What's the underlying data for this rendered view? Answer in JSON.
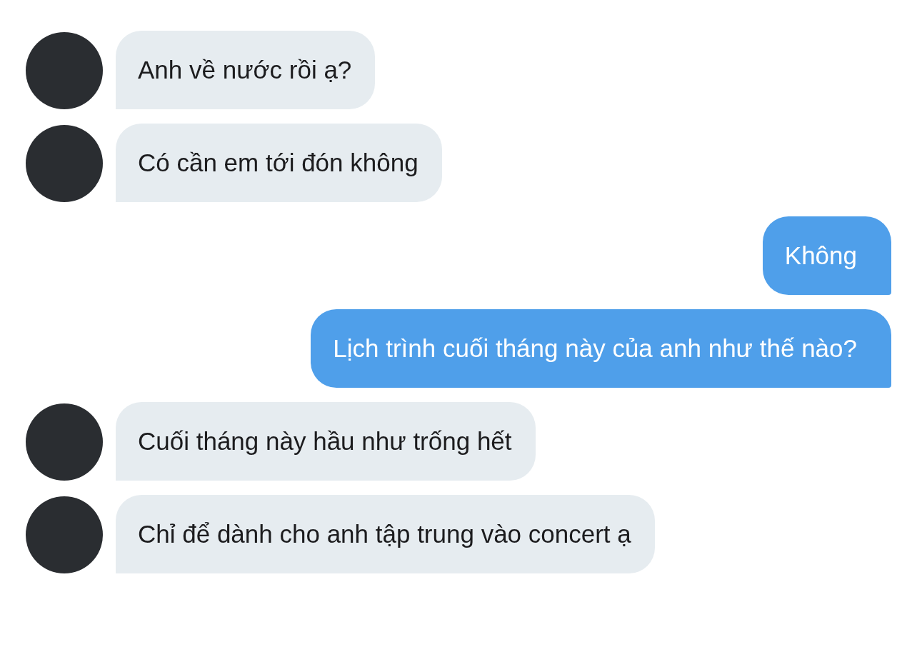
{
  "messages": [
    {
      "kind": "incoming",
      "text": "Anh về nước rồi ạ?"
    },
    {
      "kind": "incoming",
      "text": "Có cần em tới đón không"
    },
    {
      "kind": "outgoing",
      "text": "Không"
    },
    {
      "kind": "outgoing",
      "text": "Lịch trình cuối tháng này của anh như thế nào?"
    },
    {
      "kind": "incoming",
      "text": "Cuối tháng này hầu như trống hết"
    },
    {
      "kind": "incoming",
      "text": "Chỉ để dành cho anh tập trung vào concert ạ"
    }
  ]
}
